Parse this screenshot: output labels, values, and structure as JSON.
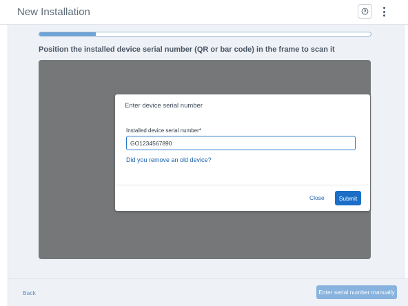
{
  "header": {
    "title": "New Installation",
    "help_icon": "question-circle-icon",
    "menu_icon": "kebab-icon"
  },
  "progress": {
    "value": 0.17
  },
  "instruction": "Position the installed device serial number (QR or bar code) in the frame to scan it",
  "dialog": {
    "title": "Enter device serial number",
    "field_label": "Installed device serial number*",
    "field_value": "GO1234567890",
    "old_device_link": "Did you remove an old device?",
    "close_label": "Close",
    "submit_label": "Submit"
  },
  "footer": {
    "back_label": "Back",
    "manual_label": "Enter serial number manually"
  },
  "colors": {
    "accent": "#1a6ec7",
    "link": "#1d63ad",
    "camera_bg": "#757779"
  }
}
